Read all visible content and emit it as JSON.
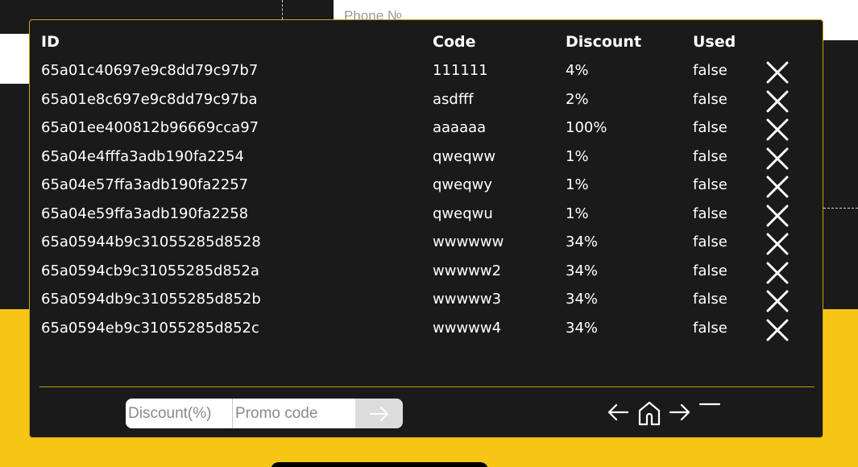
{
  "background": {
    "phone_placeholder": "Phone №"
  },
  "table": {
    "headers": {
      "id": "ID",
      "code": "Code",
      "discount": "Discount",
      "used": "Used"
    },
    "rows": [
      {
        "id": "65a01c40697e9c8dd79c97b7",
        "code": "111111",
        "discount": "4%",
        "used": "false"
      },
      {
        "id": "65a01e8c697e9c8dd79c97ba",
        "code": "asdfff",
        "discount": "2%",
        "used": "false"
      },
      {
        "id": "65a01ee400812b96669cca97",
        "code": "aaaaaa",
        "discount": "100%",
        "used": "false"
      },
      {
        "id": "65a04e4fffa3adb190fa2254",
        "code": "qweqww",
        "discount": "1%",
        "used": "false"
      },
      {
        "id": "65a04e57ffa3adb190fa2257",
        "code": "qweqwy",
        "discount": "1%",
        "used": "false"
      },
      {
        "id": "65a04e59ffa3adb190fa2258",
        "code": "qweqwu",
        "discount": "1%",
        "used": "false"
      },
      {
        "id": "65a05944b9c31055285d8528",
        "code": "wwwwww",
        "discount": "34%",
        "used": "false"
      },
      {
        "id": "65a0594cb9c31055285d852a",
        "code": "wwwww2",
        "discount": "34%",
        "used": "false"
      },
      {
        "id": "65a0594db9c31055285d852b",
        "code": "wwwww3",
        "discount": "34%",
        "used": "false"
      },
      {
        "id": "65a0594eb9c31055285d852c",
        "code": "wwwww4",
        "discount": "34%",
        "used": "false"
      }
    ],
    "delete_icon": "close-icon"
  },
  "form": {
    "discount_placeholder": "Discount(%)",
    "code_placeholder": "Promo code",
    "discount_value": "",
    "code_value": "",
    "submit_icon": "arrow-right-icon"
  },
  "pagination": {
    "prev_icon": "arrow-left-icon",
    "home_icon": "home-icon",
    "next_icon": "arrow-right-icon",
    "minimize_icon": "minus-icon"
  },
  "colors": {
    "modal_bg": "#1a1a1a",
    "accent_yellow": "#f7c516",
    "border_gold": "#c9a412",
    "text": "#ffffff"
  }
}
